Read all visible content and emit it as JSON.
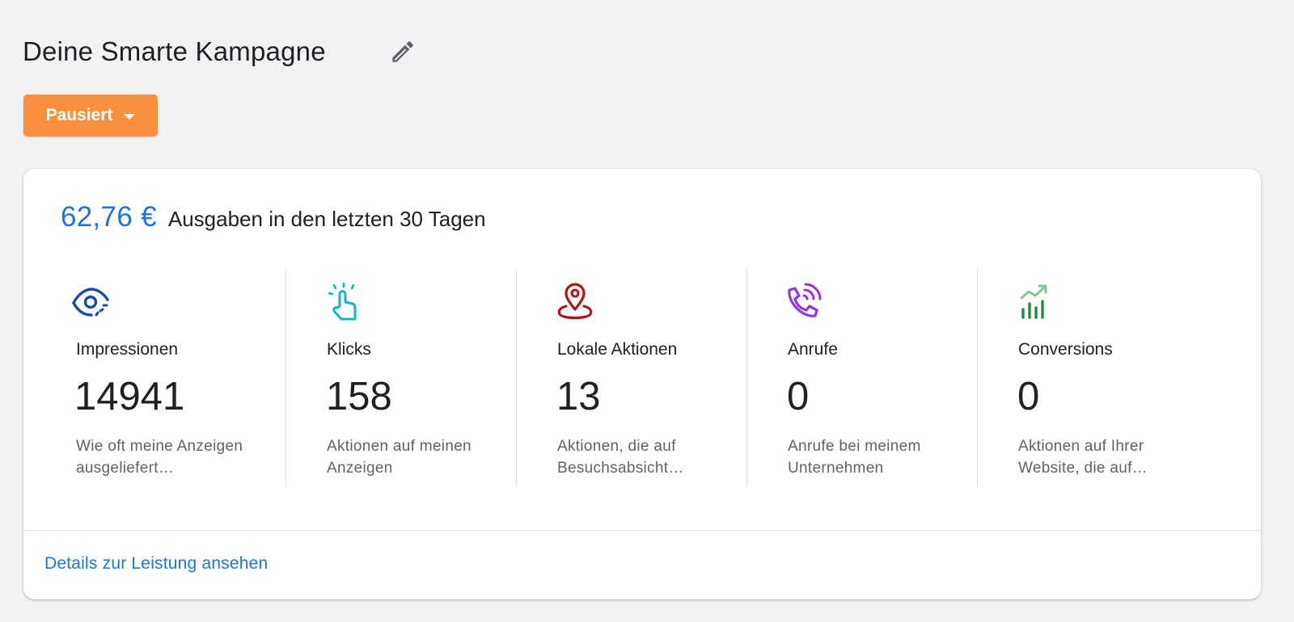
{
  "campaign": {
    "title": "Deine Smarte Kampagne",
    "status_label": "Pausiert"
  },
  "summary": {
    "spend_value": "62,76 €",
    "spend_label": "Ausgaben in den letzten 30 Tagen"
  },
  "metrics": [
    {
      "title": "Impressionen",
      "value": "14941",
      "description": "Wie oft meine Anzeigen ausgeliefert…",
      "icon": "eye-icon",
      "color": "#174ea6"
    },
    {
      "title": "Klicks",
      "value": "158",
      "description": "Aktionen auf meinen Anzeigen",
      "icon": "tap-icon",
      "color": "#12b5cb"
    },
    {
      "title": "Lokale Aktionen",
      "value": "13",
      "description": "Aktionen, die auf Besuchsabsicht…",
      "icon": "location-pin-icon",
      "color": "#b31412"
    },
    {
      "title": "Anrufe",
      "value": "0",
      "description": "Anrufe bei meinem Unternehmen",
      "icon": "phone-call-icon",
      "color": "#9334e6"
    },
    {
      "title": "Conversions",
      "value": "0",
      "description": "Aktionen auf Ihrer Website, die auf…",
      "icon": "trend-chart-icon",
      "color": "#1e8e3e"
    }
  ],
  "footer": {
    "details_link": "Details zur Leistung ansehen"
  },
  "colors": {
    "accent": "#1a73e8",
    "status_paused": "#fa903e",
    "background": "#f1f2f4"
  }
}
